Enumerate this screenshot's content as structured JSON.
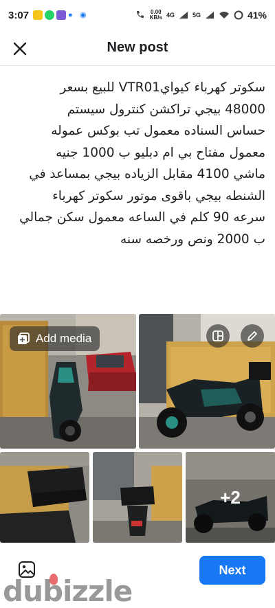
{
  "status_bar": {
    "time": "3:07",
    "data_speed": "0.00",
    "data_unit": "KB/s",
    "network": "4G",
    "network2": "5G",
    "battery": "41%"
  },
  "header": {
    "title": "New post",
    "close_icon": "close-icon"
  },
  "post": {
    "lines": [
      "سكوتر كهرباء كيواي‎VTR01‎ للبيع بسعر",
      "48000 بيجي تراكشن كنترول سيستم",
      "حساس السناده معمول تب بوكس عموله",
      "معمول مفتاح بي ام دبليو ب 1000 جنيه",
      "ماشي 4100 مقابل الزياده بيجي بمساعد في",
      "الشنطه بيجي باقوى موتور سكوتر كهرباء",
      "سرعه 90 كلم في الساعه معمول سكن جمالي",
      "ب 2000 ونص ورخصه سنه"
    ]
  },
  "media": {
    "add_label": "Add media",
    "extra_count": "+2",
    "edit_icon": "pencil-icon",
    "layout_icon": "grid-layout-icon"
  },
  "footer": {
    "next_label": "Next",
    "photo_icon": "photo-icon"
  },
  "watermark": "dubizzle",
  "colors": {
    "accent": "#1877f2",
    "text": "#1c1e21"
  }
}
